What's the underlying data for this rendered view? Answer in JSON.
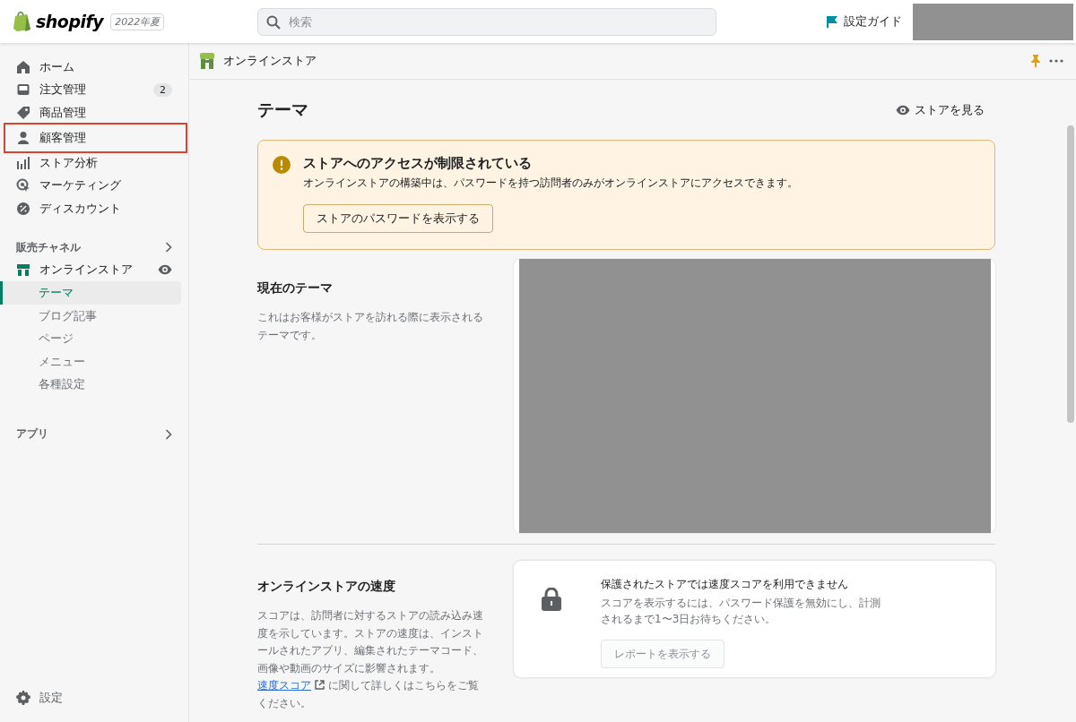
{
  "topbar": {
    "logo_text": "shopify",
    "edition_badge": "2022年夏",
    "search": {
      "placeholder": "検索"
    },
    "setup_guide": "設定ガイド"
  },
  "sidebar": {
    "items": [
      {
        "label": "ホーム",
        "highlighted": false
      },
      {
        "label": "注文管理",
        "highlighted": false,
        "badge": "2"
      },
      {
        "label": "商品管理",
        "highlighted": false
      },
      {
        "label": "顧客管理",
        "highlighted": true
      },
      {
        "label": "ストア分析",
        "highlighted": false
      },
      {
        "label": "マーケティング",
        "highlighted": false
      },
      {
        "label": "ディスカウント",
        "highlighted": false
      }
    ],
    "channels": {
      "heading": "販売チャネル",
      "channel": "オンラインストア",
      "subitems": [
        {
          "label": "テーマ",
          "selected": true
        },
        {
          "label": "ブログ記事",
          "selected": false
        },
        {
          "label": "ページ",
          "selected": false
        },
        {
          "label": "メニュー",
          "selected": false
        },
        {
          "label": "各種設定",
          "selected": false
        }
      ]
    },
    "apps": {
      "heading": "アプリ"
    },
    "settings": "設定"
  },
  "subheader": {
    "title": "オンラインストア"
  },
  "page": {
    "title": "テーマ",
    "view_store": "ストアを見る"
  },
  "banner": {
    "title": "ストアへのアクセスが制限されている",
    "body": "オンラインストアの構築中は、パスワードを持つ訪問者のみがオンラインストアにアクセスできます。",
    "button": "ストアのパスワードを表示する"
  },
  "current_theme": {
    "heading": "現在のテーマ",
    "description": "これはお客様がストアを訪れる際に表示されるテーマです。"
  },
  "speed": {
    "heading": "オンラインストアの速度",
    "description_before": "スコアは、訪問者に対するストアの読み込み速度を示しています。ストアの速度は、インストールされたアプリ、編集されたテーマコード、画像や動画のサイズに影響されます。",
    "link": "速度スコア",
    "description_after": " に関して詳しくはこちらをご覧ください。",
    "card": {
      "title": "保護されたストアでは速度スコアを利用できません",
      "body": "スコアを表示するには、パスワード保護を無効にし、計測されるまで1〜3日お待ちください。",
      "button": {
        "label": "レポートを表示する",
        "disabled": true
      }
    }
  }
}
